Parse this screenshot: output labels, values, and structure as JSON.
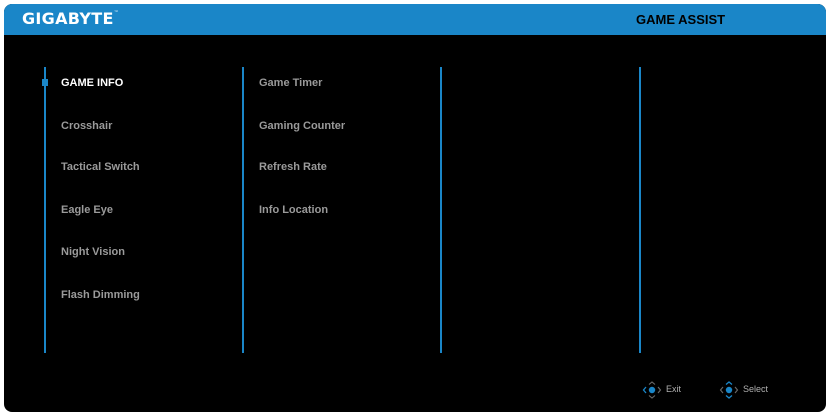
{
  "header": {
    "brand": "GIGABYTE",
    "trademark": "™",
    "title": "GAME ASSIST"
  },
  "main_menu": {
    "items": [
      {
        "label": "GAME INFO",
        "active": true
      },
      {
        "label": "Crosshair",
        "active": false
      },
      {
        "label": "Tactical Switch",
        "active": false
      },
      {
        "label": "Eagle Eye",
        "active": false
      },
      {
        "label": "Night Vision",
        "active": false
      },
      {
        "label": "Flash Dimming",
        "active": false
      }
    ]
  },
  "sub_menu": {
    "items": [
      {
        "label": "Game Timer"
      },
      {
        "label": "Gaming Counter"
      },
      {
        "label": "Refresh Rate"
      },
      {
        "label": "Info Location"
      }
    ]
  },
  "footer": {
    "exit_label": "Exit",
    "exit_icon": "joystick-left-icon",
    "select_label": "Select",
    "select_icon": "joystick-updown-icon"
  },
  "colors": {
    "background": "#000000",
    "accent": "#1a86c8",
    "text_active": "#ffffff",
    "text_inactive": "#9a9a9a"
  }
}
